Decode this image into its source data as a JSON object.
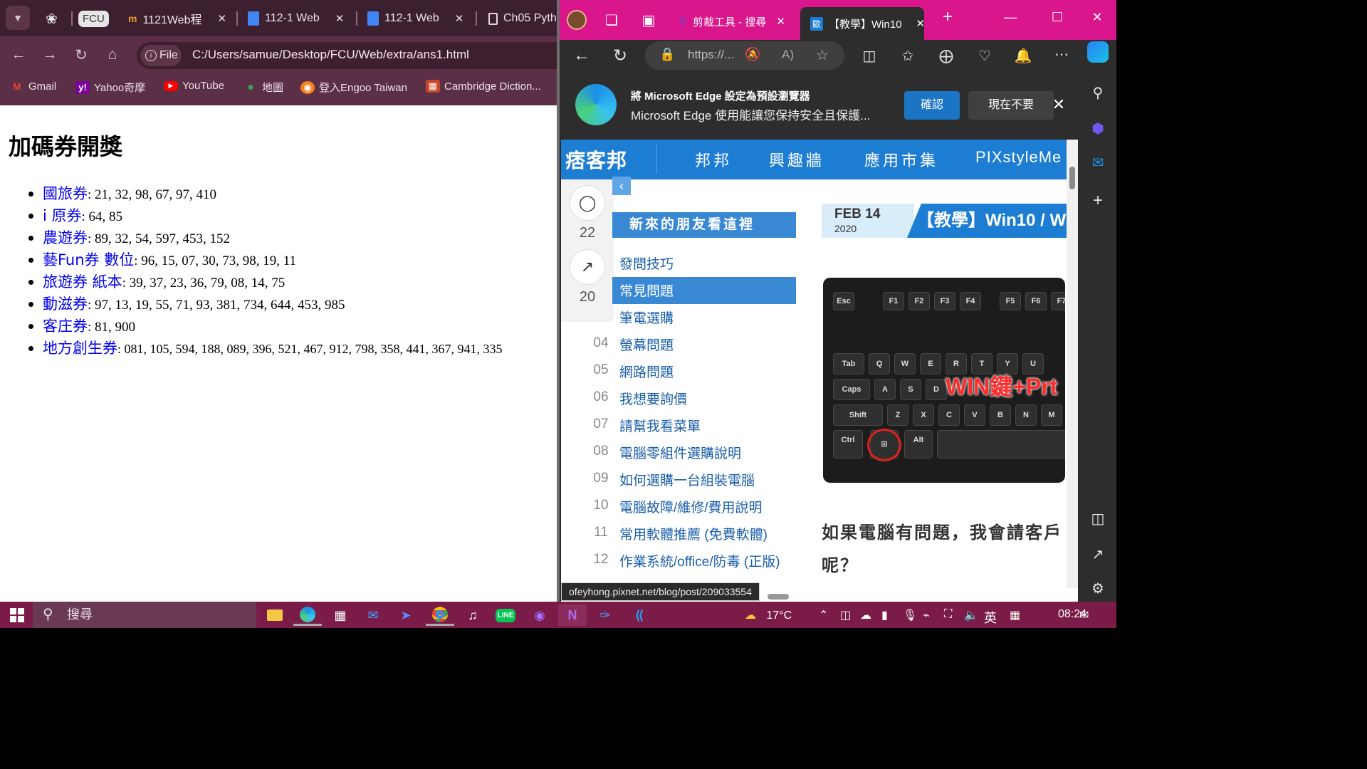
{
  "chrome": {
    "tabs": [
      {
        "label": "FCU"
      },
      {
        "label": "1121Web程"
      },
      {
        "label": "112-1 Web"
      },
      {
        "label": "112-1 Web"
      },
      {
        "label": "Ch05 Pyth"
      }
    ],
    "omnibox": {
      "chip": "File",
      "url": "C:/Users/samue/Desktop/FCU/Web/extra/ans1.html"
    },
    "bookmarks": [
      "Gmail",
      "Yahoo奇摩",
      "YouTube",
      "地圖",
      "登入Engoo Taiwan",
      "Cambridge Diction..."
    ],
    "page": {
      "heading": "加碼券開獎",
      "items": [
        {
          "name": "國旅券",
          "numbers": ": 21, 32, 98, 67, 97, 410"
        },
        {
          "name": "i 原券",
          "numbers": ": 64, 85"
        },
        {
          "name": "農遊券",
          "numbers": ": 89, 32, 54, 597, 453, 152"
        },
        {
          "name": "藝Fun券 數位",
          "numbers": ": 96, 15, 07, 30, 73, 98, 19, 11"
        },
        {
          "name": "旅遊券 紙本",
          "numbers": ": 39, 37, 23, 36, 79, 08, 14, 75"
        },
        {
          "name": "動滋券",
          "numbers": ": 97, 13, 19, 55, 71, 93, 381, 734, 644, 453, 985"
        },
        {
          "name": "客庄券",
          "numbers": ": 81, 900"
        },
        {
          "name": "地方創生券",
          "numbers": ": 081, 105, 594, 188, 089, 396, 521, 467, 912, 798, 358, 441, 367, 941, 335"
        }
      ]
    }
  },
  "edge": {
    "tabs": [
      {
        "label": "剪裁工具 - 搜尋"
      },
      {
        "label": "【教學】Win10"
      }
    ],
    "omnibox": {
      "url": "https://..."
    },
    "infobar": {
      "title": "將 Microsoft Edge 設定為預設瀏覽器",
      "body": "Microsoft Edge 使用能讓您保持安全且保護...",
      "confirm": "確認",
      "later": "現在不要"
    },
    "site": {
      "logo": "痞客邦",
      "menu": [
        "邦邦",
        "興趣牆",
        "應用市集",
        "PIXstyleMe"
      ],
      "comments": "22",
      "shares": "20",
      "toc_heading": "新來的朋友看這裡",
      "toc": [
        {
          "n": "",
          "t": "發問技巧"
        },
        {
          "n": "",
          "t": "常見問題"
        },
        {
          "n": "",
          "t": "筆電選購"
        },
        {
          "n": "04",
          "t": "螢幕問題"
        },
        {
          "n": "05",
          "t": "網路問題"
        },
        {
          "n": "06",
          "t": "我想要詢價"
        },
        {
          "n": "07",
          "t": "請幫我看菜單"
        },
        {
          "n": "08",
          "t": "電腦零組件選購說明"
        },
        {
          "n": "09",
          "t": "如何選購一台組裝電腦"
        },
        {
          "n": "10",
          "t": "電腦故障/維修/費用說明"
        },
        {
          "n": "11",
          "t": "常用軟體推薦 (免費軟體)"
        },
        {
          "n": "12",
          "t": "作業系統/office/防毒 (正版)"
        }
      ],
      "date_month_day": "FEB 14",
      "date_year": "2020",
      "post_title": "【教學】Win10 / W",
      "image_caption": "WIN鍵+Prt",
      "post_text_1": "如果電腦有問題，我會請客戶",
      "post_text_2": "呢？",
      "status_url": "ofeyhong.pixnet.net/blog/post/209033554"
    }
  },
  "taskbar": {
    "search_placeholder": "搜尋",
    "weather": "17°C",
    "ime": "英",
    "time": "08:24"
  },
  "colors": {
    "chrome_frame": "#5b2f45",
    "edge_frame": "#d9168c",
    "taskbar": "#7a1b48",
    "pixnet_blue": "#1d7dd3"
  }
}
